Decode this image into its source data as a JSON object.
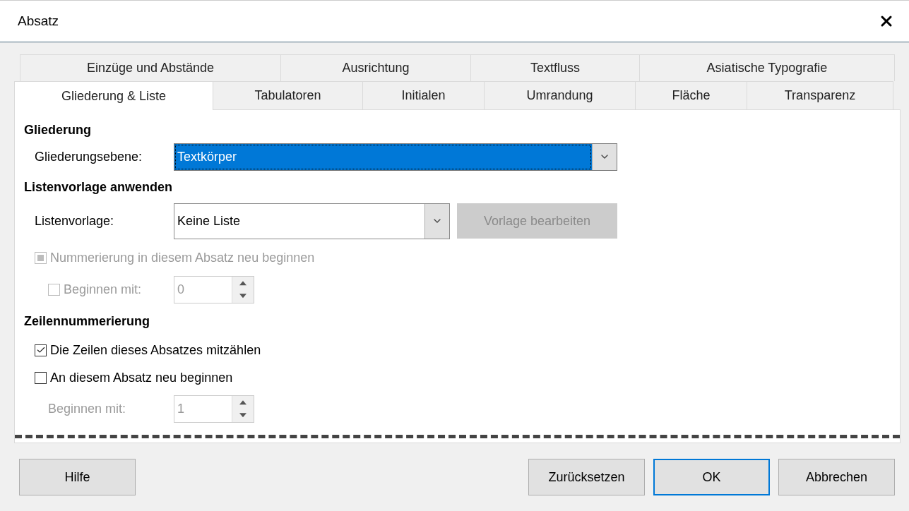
{
  "window": {
    "title": "Absatz"
  },
  "tab_rows": [
    [
      {
        "label": "Einzüge und Abstände",
        "selected": false
      },
      {
        "label": "Ausrichtung",
        "selected": false
      },
      {
        "label": "Textfluss",
        "selected": false
      },
      {
        "label": "Asiatische Typografie",
        "selected": false
      }
    ],
    [
      {
        "label": "Gliederung & Liste",
        "selected": true
      },
      {
        "label": "Tabulatoren",
        "selected": false
      },
      {
        "label": "Initialen",
        "selected": false
      },
      {
        "label": "Umrandung",
        "selected": false
      },
      {
        "label": "Fläche",
        "selected": false
      },
      {
        "label": "Transparenz",
        "selected": false
      }
    ]
  ],
  "outline": {
    "heading": "Gliederung",
    "level_label": "Gliederungsebene:",
    "level_value": "Textkörper",
    "highlighted": true
  },
  "list_style": {
    "heading": "Listenvorlage anwenden",
    "style_label": "Listenvorlage:",
    "style_value": "Keine Liste",
    "edit_button": {
      "label": "Vorlage bearbeiten",
      "disabled": true
    },
    "restart": {
      "label": "Nummerierung in diesem Absatz neu beginnen",
      "checked": false,
      "indeterminate": true,
      "disabled": true
    },
    "start_with": {
      "label": "Beginnen mit:",
      "checked": false,
      "disabled": true,
      "value": "0"
    }
  },
  "line_numbering": {
    "heading": "Zeilennummerierung",
    "count_lines": {
      "label": "Die Zeilen dieses Absatzes mitzählen",
      "checked": true,
      "disabled": false
    },
    "restart": {
      "label": "An diesem Absatz neu beginnen",
      "checked": false,
      "disabled": false
    },
    "start_with": {
      "label": "Beginnen mit:",
      "value": "1",
      "disabled": true
    }
  },
  "buttons": [
    {
      "label": "Hilfe",
      "default": false
    },
    {
      "label": "Zurücksetzen",
      "default": false
    },
    {
      "label": "OK",
      "default": true
    },
    {
      "label": "Abbrechen",
      "default": false
    }
  ]
}
